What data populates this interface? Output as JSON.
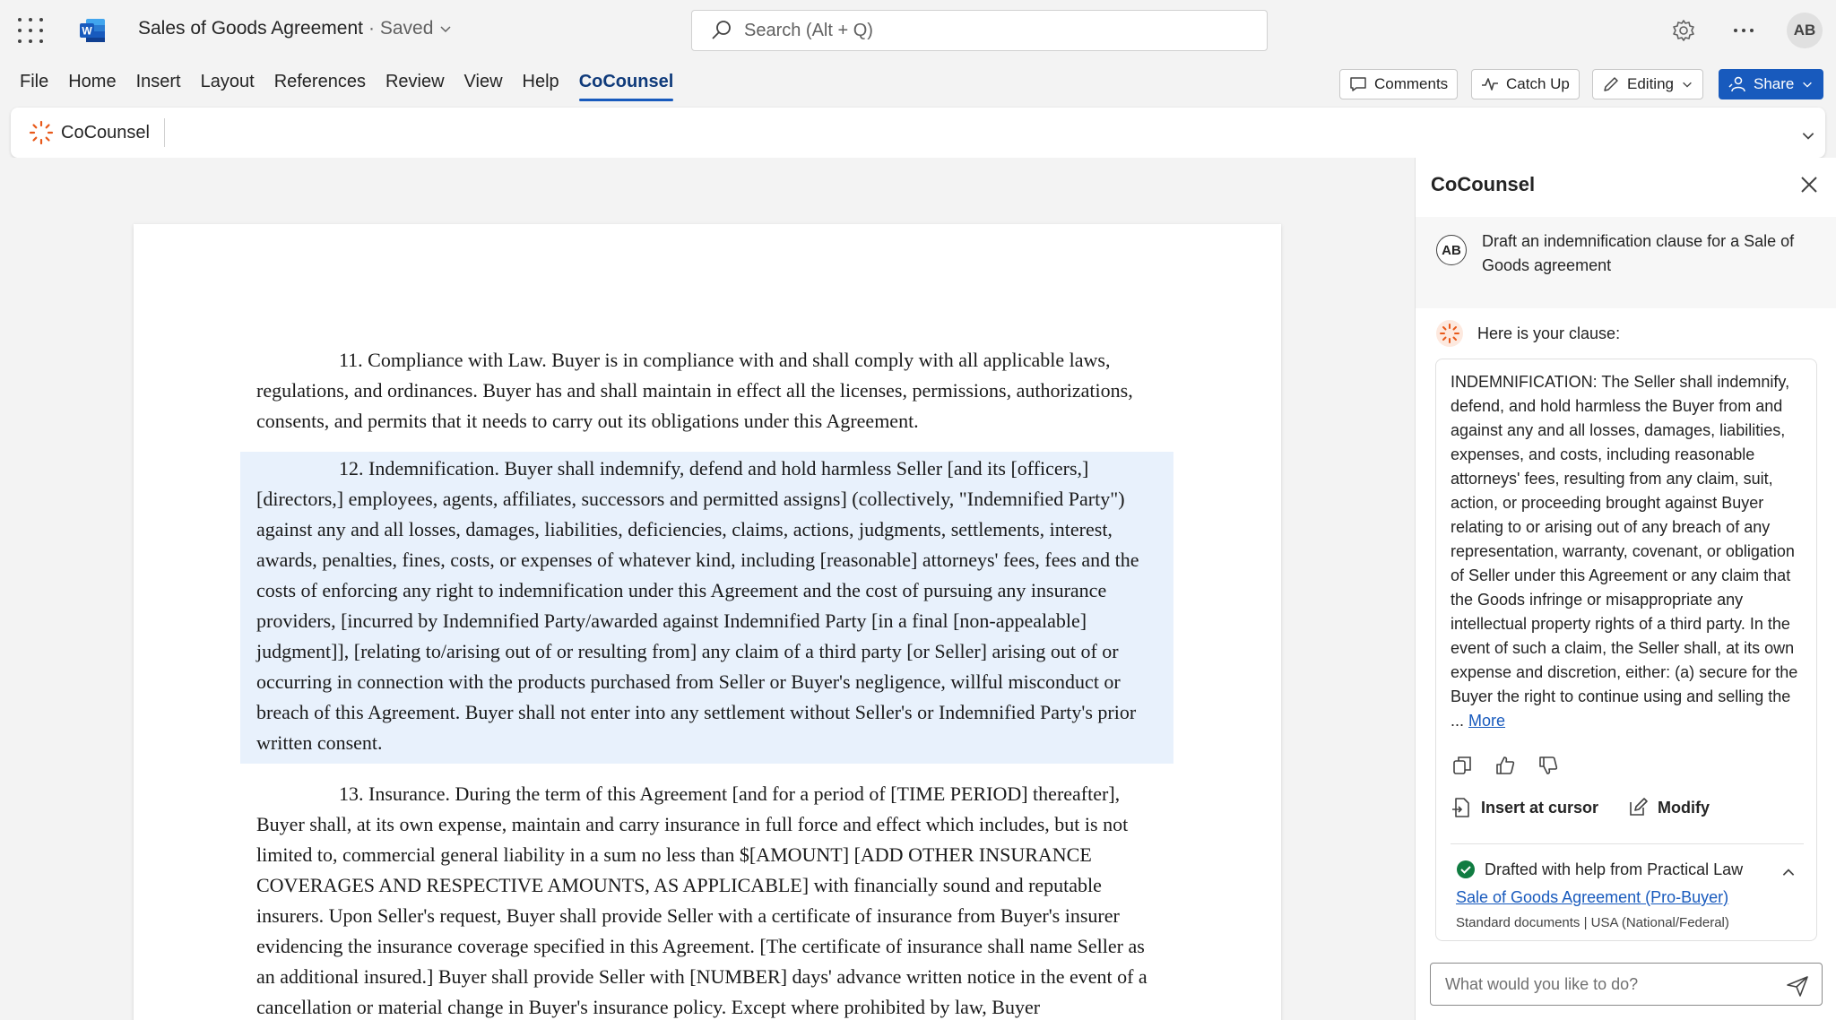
{
  "app": {
    "doc_title": "Sales of Goods Agreement",
    "save_status": "· Saved",
    "user_initials": "AB"
  },
  "search": {
    "placeholder": "Search (Alt + Q)"
  },
  "menu": {
    "tabs": [
      "File",
      "Home",
      "Insert",
      "Layout",
      "References",
      "Review",
      "View",
      "Help",
      "CoCounsel"
    ],
    "active_tab": "CoCounsel",
    "comments_label": "Comments",
    "catchup_label": "Catch Up",
    "editing_label": "Editing",
    "share_label": "Share"
  },
  "ribbon": {
    "cocounsel_label": "CoCounsel"
  },
  "document": {
    "paragraphs": [
      "11. Compliance with Law. Buyer is in compliance with and shall comply with all applicable laws, regulations, and ordinances. Buyer has and shall maintain in effect all the licenses, permissions, authorizations, consents, and permits that it needs to carry out its obligations under this Agreement.",
      "12. Indemnification. Buyer shall indemnify, defend and hold harmless Seller [and its [officers,] [directors,] employees, agents, affiliates, successors and permitted assigns] (collectively, \"Indemnified Party\") against any and all losses, damages, liabilities, deficiencies, claims, actions, judgments, settlements, interest, awards, penalties, fines, costs, or expenses of whatever kind, including [reasonable] attorneys' fees, fees and the costs of enforcing any right to indemnification under this Agreement and the cost of pursuing any insurance providers, [incurred by Indemnified Party/awarded against Indemnified Party [in a final [non-appealable] judgment]], [relating to/arising out of or resulting from] any claim of a third party [or Seller] arising out of or occurring in connection with the products purchased from Seller or Buyer's negligence, willful misconduct or breach of this Agreement. Buyer shall not enter into any settlement without Seller's or Indemnified Party's prior written consent.",
      "13. Insurance. During the term of this Agreement [and for a period of [TIME PERIOD] thereafter], Buyer shall, at its own expense, maintain and carry insurance in full force and effect which includes, but is not limited to, commercial general liability in a sum no less than $[AMOUNT] [ADD OTHER INSURANCE COVERAGES AND RESPECTIVE AMOUNTS, AS APPLICABLE] with financially sound and reputable insurers. Upon Seller's request, Buyer shall provide Seller with a certificate of insurance from Buyer's insurer evidencing the insurance coverage specified in this Agreement. [The certificate of insurance shall name Seller as an additional insured.] Buyer shall provide Seller with [NUMBER] days' advance written notice in the event of a cancellation or material change in Buyer's insurance policy. Except where prohibited by law, Buyer"
    ]
  },
  "panel": {
    "title": "CoCounsel",
    "user_initials": "AB",
    "user_message": "Draft an indemnification clause for a Sale of Goods agreement",
    "bot_intro": "Here is your clause:",
    "clause_text": "INDEMNIFICATION: The Seller shall indemnify, defend, and hold harmless the Buyer from and against any and all losses, damages, liabilities, expenses, and costs, including reasonable attorneys' fees, resulting from any claim, suit, action, or proceeding brought against Buyer relating to or arising out of any breach of any representation, warranty, covenant, or obligation of Seller under this Agreement or any claim that the Goods infringe or misappropriate any intellectual property rights of a third party. In the event of such a claim, the Seller shall, at its own expense and discretion, either: (a) secure for the Buyer the right to continue using and selling the ...",
    "more_label": "More",
    "insert_label": "Insert at cursor",
    "modify_label": "Modify",
    "drafted_label": "Drafted with help from Practical Law",
    "source_link": "Sale of Goods Agreement (Pro-Buyer)",
    "source_meta": "Standard documents | USA (National/Federal)",
    "prompt_placeholder": "What would you like to do?"
  },
  "colors": {
    "accent": "#185abd",
    "highlight": "#e8f1fc",
    "success": "#107c41",
    "cocounsel_orange": "#e8591a"
  }
}
